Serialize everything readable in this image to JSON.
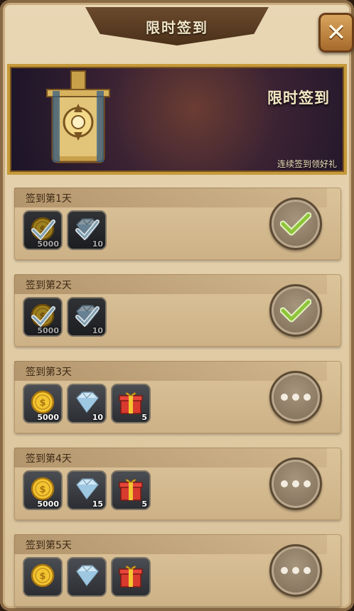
{
  "header": {
    "title": "限时签到",
    "close_icon": "close-x-icon"
  },
  "banner": {
    "title": "限时签到",
    "subtitle": "连续签到领好礼",
    "emblem_icon": "sword-shield-banner-icon"
  },
  "days": [
    {
      "label": "签到第1天",
      "status": "claimed",
      "rewards": [
        {
          "icon": "gold-coin-icon",
          "qty": "5000"
        },
        {
          "icon": "diamond-icon",
          "qty": "10"
        }
      ]
    },
    {
      "label": "签到第2天",
      "status": "claimed",
      "rewards": [
        {
          "icon": "gold-coin-icon",
          "qty": "5000"
        },
        {
          "icon": "diamond-icon",
          "qty": "10"
        }
      ]
    },
    {
      "label": "签到第3天",
      "status": "pending",
      "rewards": [
        {
          "icon": "gold-coin-icon",
          "qty": "5000"
        },
        {
          "icon": "diamond-icon",
          "qty": "10"
        },
        {
          "icon": "gift-box-icon",
          "qty": "5"
        }
      ]
    },
    {
      "label": "签到第4天",
      "status": "pending",
      "rewards": [
        {
          "icon": "gold-coin-icon",
          "qty": "5000"
        },
        {
          "icon": "diamond-icon",
          "qty": "15"
        },
        {
          "icon": "gift-box-icon",
          "qty": "5"
        }
      ]
    },
    {
      "label": "签到第5天",
      "status": "pending",
      "rewards": [
        {
          "icon": "gold-coin-icon",
          "qty": ""
        },
        {
          "icon": "diamond-icon",
          "qty": ""
        },
        {
          "icon": "gift-box-icon",
          "qty": ""
        }
      ]
    }
  ],
  "colors": {
    "accent_gold": "#c79a3a",
    "parchment": "#dcc49a",
    "tick_green": "#8fc43a"
  }
}
